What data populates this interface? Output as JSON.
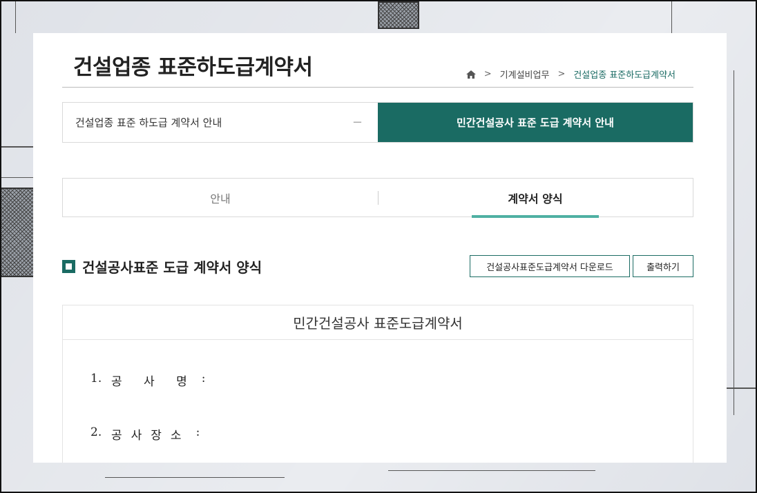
{
  "page": {
    "title": "건설업종 표준하도급계약서"
  },
  "breadcrumb": {
    "home_icon": "home-icon",
    "items": [
      "기계설비업무",
      "건설업종 표준하도급계약서"
    ],
    "separator": ">"
  },
  "section_tabs": {
    "left_label": "건설업종 표준 하도급 계약서 안내",
    "left_marker": "−",
    "right_label": "민간건설공사 표준 도급 계약서 안내"
  },
  "sub_tabs": {
    "tab1": "안내",
    "tab2": "계약서 양식",
    "active": "계약서 양식"
  },
  "form": {
    "heading": "건설공사표준 도급 계약서 양식",
    "download_button": "건설공사표준도급계약서 다운로드",
    "print_button": "출력하기"
  },
  "document": {
    "title": "민간건설공사 표준도급계약서",
    "items": [
      {
        "num": "1.",
        "label": "공 사 명",
        "colon": ":"
      },
      {
        "num": "2.",
        "label": "공사장소",
        "colon": ":"
      }
    ]
  },
  "colors": {
    "accent": "#1a6b63",
    "underline": "#4fb0a3",
    "icon_orange": "#e87722"
  }
}
